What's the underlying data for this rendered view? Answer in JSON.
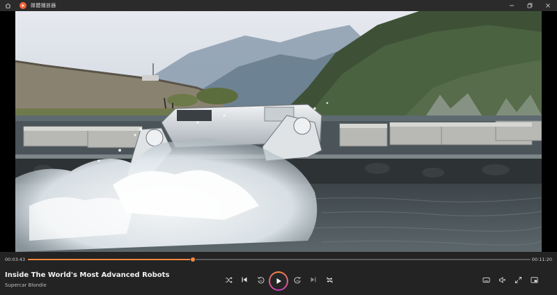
{
  "window": {
    "title": "媒體播放器"
  },
  "player": {
    "current_time": "00:03:43",
    "total_time": "00:11:20",
    "progress_fraction": 0.328,
    "media_title": "Inside The World's Most Advanced Robots",
    "media_subtitle": "Supercar Blondie"
  },
  "colors": {
    "accent": "#ff8a3d",
    "accent_secondary": "#c13cc8"
  },
  "icons": {
    "home": "home-icon",
    "app": "media-player-app-icon",
    "minimize": "minimize-icon",
    "restore": "restore-icon",
    "close": "close-icon",
    "shuffle": "shuffle-icon",
    "previous": "skip-previous-icon",
    "rewind": "rewind-10-icon",
    "play": "play-icon",
    "forward": "forward-30-icon",
    "next": "skip-next-icon",
    "repeat": "repeat-off-icon",
    "captions": "captions-icon",
    "volume": "volume-icon",
    "fullscreen": "fullscreen-icon",
    "miniplayer": "miniplayer-icon",
    "more": "more-icon"
  }
}
